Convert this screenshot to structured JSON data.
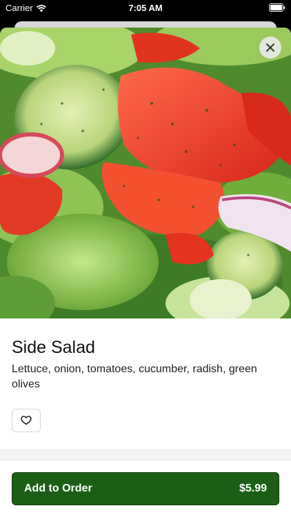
{
  "status_bar": {
    "carrier": "Carrier",
    "time": "7:05 AM"
  },
  "item": {
    "title": "Side Salad",
    "description": "Lettuce, onion, tomatoes, cucumber, radish, green olives",
    "image": "salad-photo"
  },
  "actions": {
    "close_icon": "close-icon",
    "favorite_icon": "heart-icon",
    "add_label": "Add to Order",
    "price": "$5.99"
  },
  "colors": {
    "primary_button": "#1d5e17"
  }
}
